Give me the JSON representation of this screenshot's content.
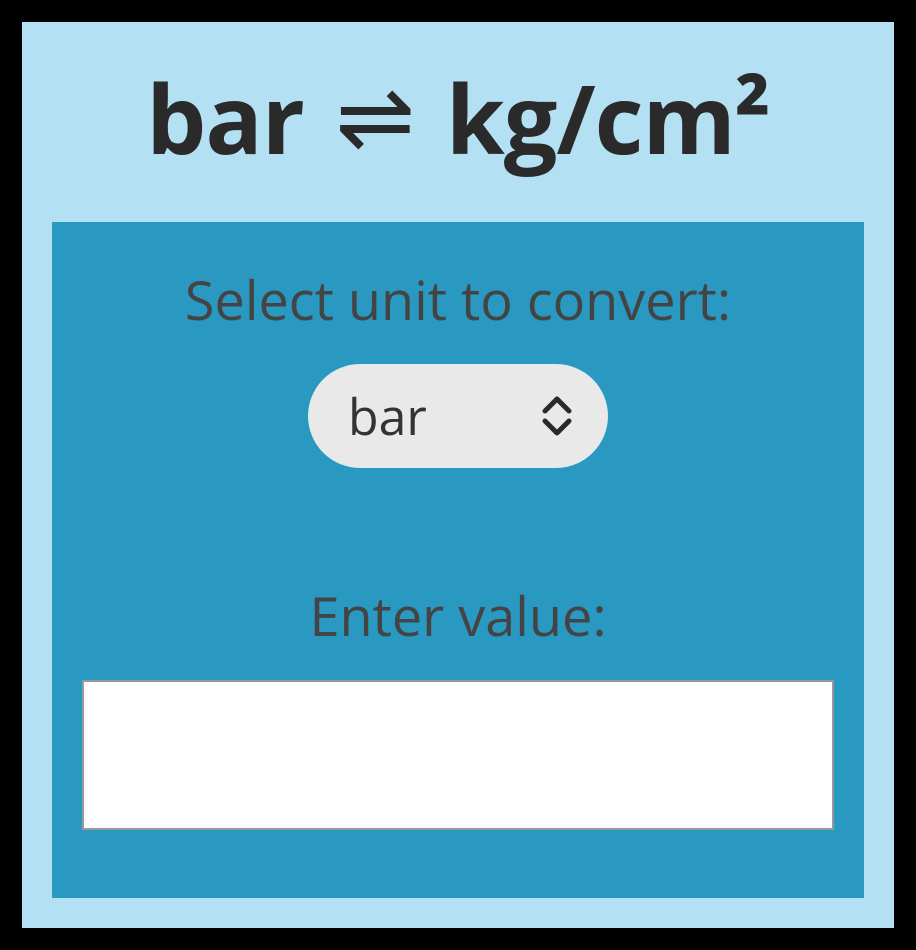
{
  "title": {
    "from_unit": "bar",
    "to_unit": "kg/cm²"
  },
  "panel": {
    "select_label": "Select unit to convert:",
    "select_value": "bar",
    "enter_label": "Enter value:",
    "input_value": ""
  }
}
